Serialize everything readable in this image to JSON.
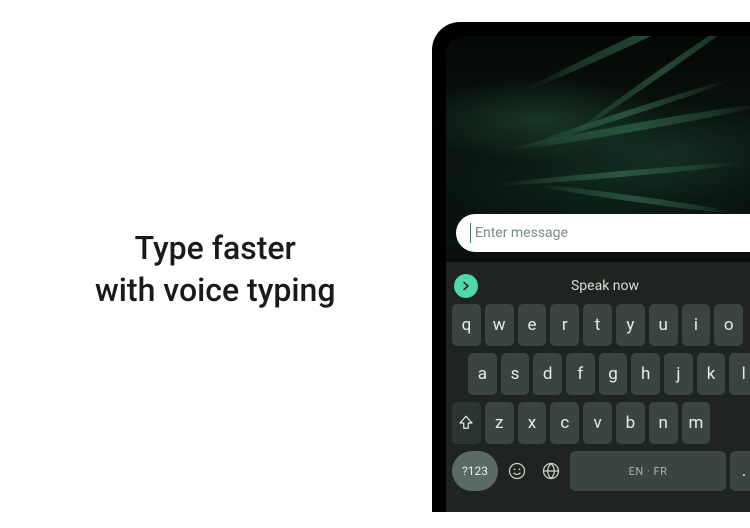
{
  "hero": {
    "line1": "Type faster",
    "line2": "with voice typing"
  },
  "chat": {
    "placeholder": "Enter message"
  },
  "keyboard": {
    "speak_label": "Speak now",
    "rows": {
      "r1": [
        "q",
        "w",
        "e",
        "r",
        "t",
        "y",
        "u",
        "i",
        "o"
      ],
      "r2": [
        "a",
        "s",
        "d",
        "f",
        "g",
        "h",
        "j",
        "k",
        "l"
      ],
      "r3": [
        "z",
        "x",
        "c",
        "v",
        "b",
        "n",
        "m"
      ]
    },
    "sym_label": "?123",
    "space_label": "EN · FR",
    "period_label": "."
  }
}
